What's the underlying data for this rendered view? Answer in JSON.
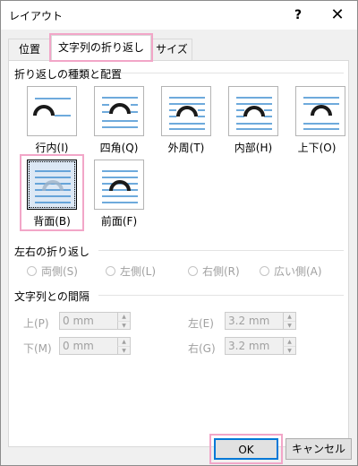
{
  "window": {
    "title": "レイアウト",
    "help": "?",
    "close": "✕"
  },
  "tabs": [
    {
      "label": "位置",
      "selected": false
    },
    {
      "label": "文字列の折り返し",
      "selected": true
    },
    {
      "label": "サイズ",
      "selected": false
    }
  ],
  "wrapping": {
    "section_label": "折り返しの種類と配置",
    "options": [
      {
        "label": "行内(I)",
        "style": "inline",
        "selected": false
      },
      {
        "label": "四角(Q)",
        "style": "square",
        "selected": false
      },
      {
        "label": "外周(T)",
        "style": "tight",
        "selected": false
      },
      {
        "label": "内部(H)",
        "style": "through",
        "selected": false
      },
      {
        "label": "上下(O)",
        "style": "topbottom",
        "selected": false
      },
      {
        "label": "背面(B)",
        "style": "behind",
        "selected": true
      },
      {
        "label": "前面(F)",
        "style": "front",
        "selected": false
      }
    ]
  },
  "wrap_side": {
    "section_label": "左右の折り返し",
    "options": [
      {
        "label": "両側(S)"
      },
      {
        "label": "左側(L)"
      },
      {
        "label": "右側(R)"
      },
      {
        "label": "広い側(A)"
      }
    ]
  },
  "distance": {
    "section_label": "文字列との間隔",
    "top": {
      "label": "上(P)",
      "value": "0 mm"
    },
    "bottom": {
      "label": "下(M)",
      "value": "0 mm"
    },
    "left": {
      "label": "左(E)",
      "value": "3.2 mm"
    },
    "right": {
      "label": "右(G)",
      "value": "3.2 mm"
    }
  },
  "buttons": {
    "ok": "OK",
    "cancel": "キャンセル"
  },
  "colors": {
    "line": "#3e8ed0",
    "shape": "#1a1a1a",
    "highlight": "#f2a6c8"
  }
}
